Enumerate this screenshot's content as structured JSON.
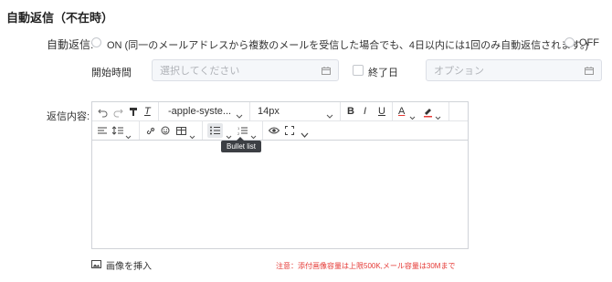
{
  "section_title": "自動返信（不在時）",
  "auto_reply": {
    "label": "自動返信:",
    "on_text": "ON (同一のメールアドレスから複数のメールを受信した場合でも、4日以内には1回のみ自動返信されます。)",
    "off_text": "OFF"
  },
  "period": {
    "start_label": "開始時間",
    "start_placeholder": "選択してください",
    "end_label": "終了日",
    "end_placeholder": "オプション"
  },
  "content": {
    "label": "返信内容:"
  },
  "toolbar": {
    "font_family": "-apple-syste...",
    "font_size": "14px",
    "bold": "B",
    "italic": "I",
    "underline": "U",
    "font_color": "A",
    "tooltip": "Bullet list"
  },
  "footer": {
    "insert_image": "画像を挿入",
    "note": "注意：添付画像容量は上限500K,メール容量は30Mまで"
  },
  "colors": {
    "note_red": "#e53935",
    "tooltip_bg": "#3c3f44",
    "border": "#d0d3d8"
  }
}
